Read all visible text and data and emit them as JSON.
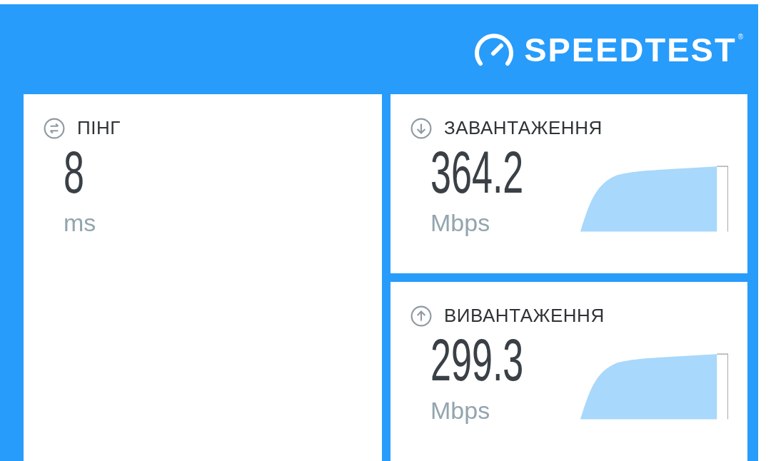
{
  "logo": {
    "text": "SPEEDTEST",
    "mark": "®"
  },
  "cards": [
    {
      "kind": "ping",
      "label": "ПІНГ",
      "value": "8",
      "unit": "ms"
    },
    {
      "kind": "download",
      "label": "ЗАВАНТАЖЕННЯ",
      "value": "364.2",
      "unit": "Mbps"
    },
    {
      "kind": "upload",
      "label": "ВИВАНТАЖЕННЯ",
      "value": "299.3",
      "unit": "Mbps"
    }
  ]
}
